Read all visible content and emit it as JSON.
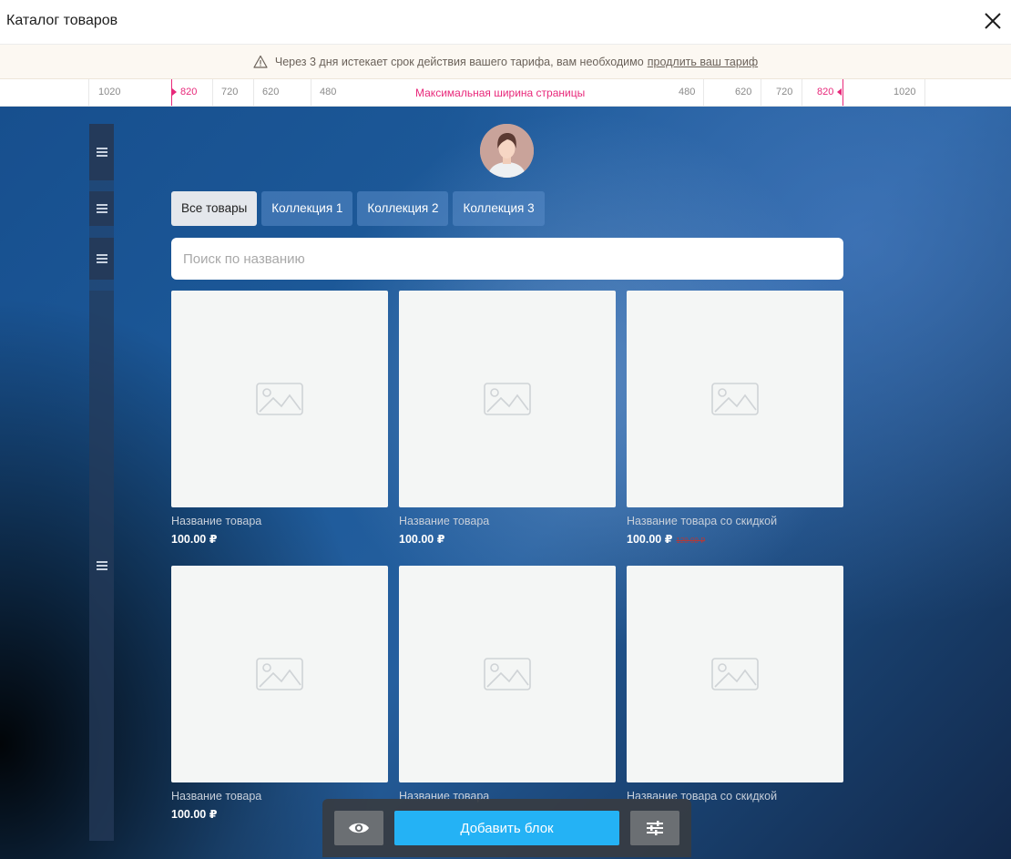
{
  "header": {
    "title": "Каталог товаров"
  },
  "banner": {
    "text": "Через 3 дня истекает срок действия вашего тарифа, вам необходимо",
    "link": "продлить ваш тариф"
  },
  "ruler": {
    "center_label": "Максимальная ширина страницы",
    "left_labels": [
      "1020",
      "820",
      "720",
      "620",
      "480"
    ],
    "right_labels": [
      "480",
      "620",
      "720",
      "820",
      "1020"
    ]
  },
  "tabs": [
    "Все товары",
    "Коллекция 1",
    "Коллекция 2",
    "Коллекция 3"
  ],
  "search": {
    "placeholder": "Поиск по названию"
  },
  "products": [
    {
      "name": "Название товара",
      "price": "100.00 ₽",
      "old_price": ""
    },
    {
      "name": "Название товара",
      "price": "100.00 ₽",
      "old_price": ""
    },
    {
      "name": "Название товара со скидкой",
      "price": "100.00 ₽",
      "old_price": "120.00 ₽"
    },
    {
      "name": "Название товара",
      "price": "100.00 ₽",
      "old_price": ""
    },
    {
      "name": "Название товара",
      "price": "",
      "old_price": ""
    },
    {
      "name": "Название товара со скидкой",
      "price": "",
      "old_price": ""
    }
  ],
  "toolbar": {
    "add_label": "Добавить блок"
  },
  "colors": {
    "accent": "#24b2f5",
    "ruler_marker": "#e8287a"
  }
}
